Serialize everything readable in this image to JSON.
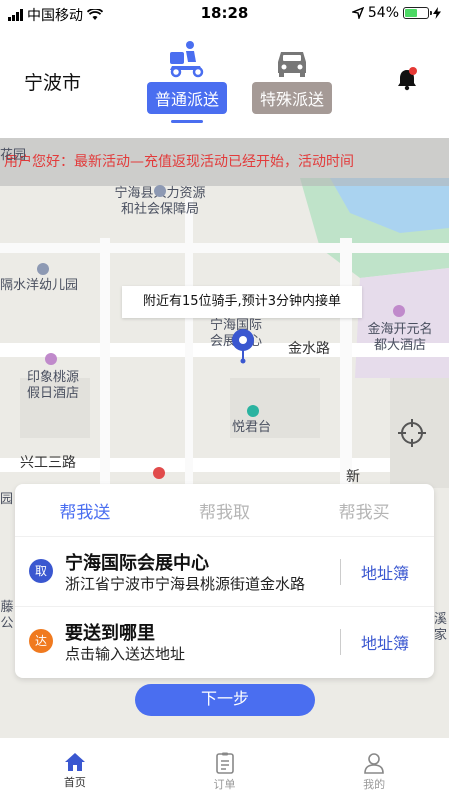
{
  "status_bar": {
    "carrier": "中国移动",
    "time": "18:28",
    "battery": "54%",
    "battery_level": 0.54,
    "battery_color": "#4cd964"
  },
  "header": {
    "city": "宁波市",
    "modes": [
      {
        "label": "普通派送",
        "icon": "scooter-courier-icon",
        "active": true
      },
      {
        "label": "特殊派送",
        "icon": "car-icon",
        "active": false
      }
    ],
    "accent": "#4a6ef0",
    "notification_icon": "bell-icon"
  },
  "map": {
    "notice": "用户您好：最新活动—充值返现活动已经开始，活动时间",
    "riders_tip": "附近有15位骑手,预计3分钟内接单",
    "labels": {
      "hua": "花园",
      "hrss": "宁海县人力资源\n和社会保障局",
      "kinder": "隔水洋幼儿园",
      "center": "宁海国际\n会展中心",
      "hotel_left": "印象桃源\n假日酒店",
      "hotel_right": "金海开元名\n都大酒店",
      "yuejun": "悦君台",
      "road_jinshui": "金水路",
      "road_xinggong": "兴工三路",
      "xin": "新",
      "yuan": "园",
      "left_edge": "藤\n公",
      "right_edge": "溪家"
    }
  },
  "panel": {
    "tabs": [
      {
        "label": "帮我送",
        "active": true
      },
      {
        "label": "帮我取",
        "active": false
      },
      {
        "label": "帮我买",
        "active": false
      }
    ],
    "pickup": {
      "badge": "取",
      "title": "宁海国际会展中心",
      "subtitle": "浙江省宁波市宁海县桃源街道金水路",
      "book": "地址簿"
    },
    "dropoff": {
      "badge": "达",
      "title": "要送到哪里",
      "subtitle": "点击输入送达地址",
      "book": "地址簿"
    }
  },
  "next_button": "下一步",
  "tabbar": [
    {
      "label": "首页",
      "icon": "home-icon",
      "active": true
    },
    {
      "label": "订单",
      "icon": "order-list-icon",
      "active": false
    },
    {
      "label": "我的",
      "icon": "profile-icon",
      "active": false
    }
  ]
}
